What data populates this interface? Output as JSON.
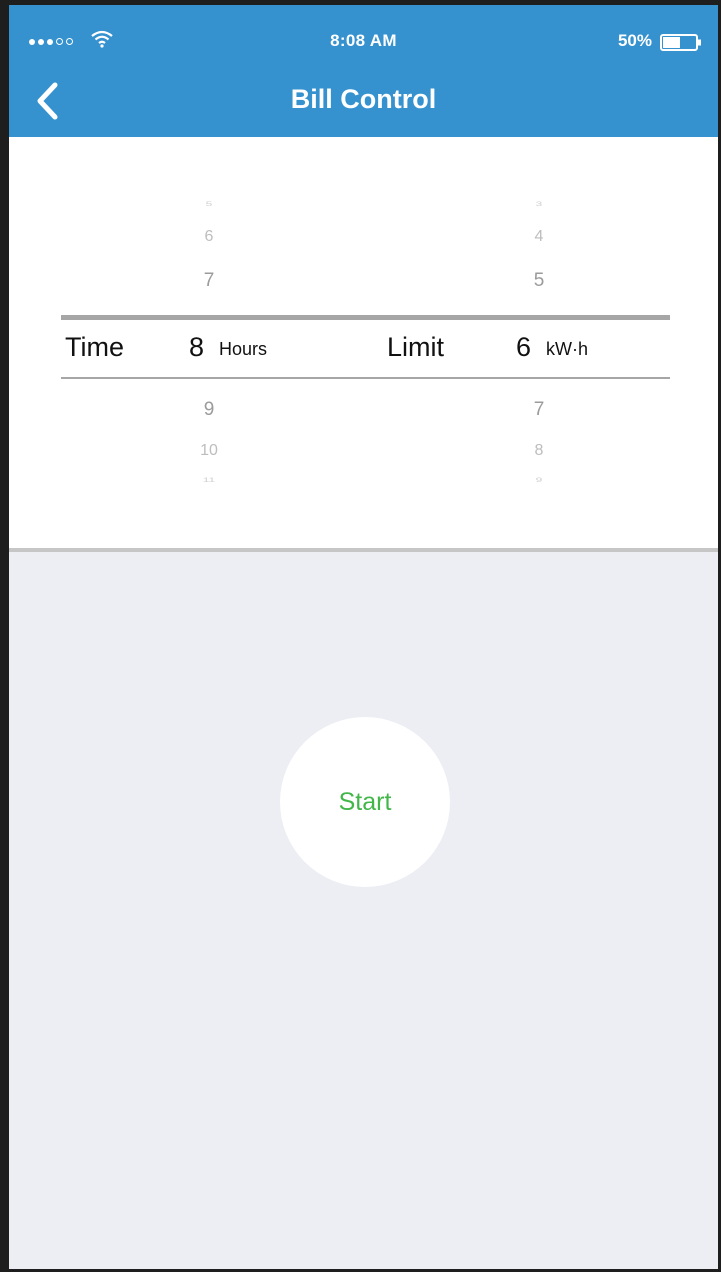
{
  "status_bar": {
    "time": "8:08 AM",
    "battery": "50%"
  },
  "nav": {
    "title": "Bill Control"
  },
  "picker": {
    "time_label": "Time",
    "hours_value": "8",
    "hours_unit": "Hours",
    "limit_label": "Limit",
    "kwh_value": "6",
    "kwh_unit": "kW·h",
    "hours_above": [
      "5",
      "6",
      "7"
    ],
    "hours_below": [
      "9",
      "10",
      "11"
    ],
    "kwh_above": [
      "3",
      "4",
      "5"
    ],
    "kwh_below": [
      "7",
      "8",
      "9"
    ]
  },
  "actions": {
    "start_label": "Start"
  },
  "colors": {
    "accent": "#3592cf",
    "start_text": "#43b64a",
    "background": "#eceef3"
  }
}
